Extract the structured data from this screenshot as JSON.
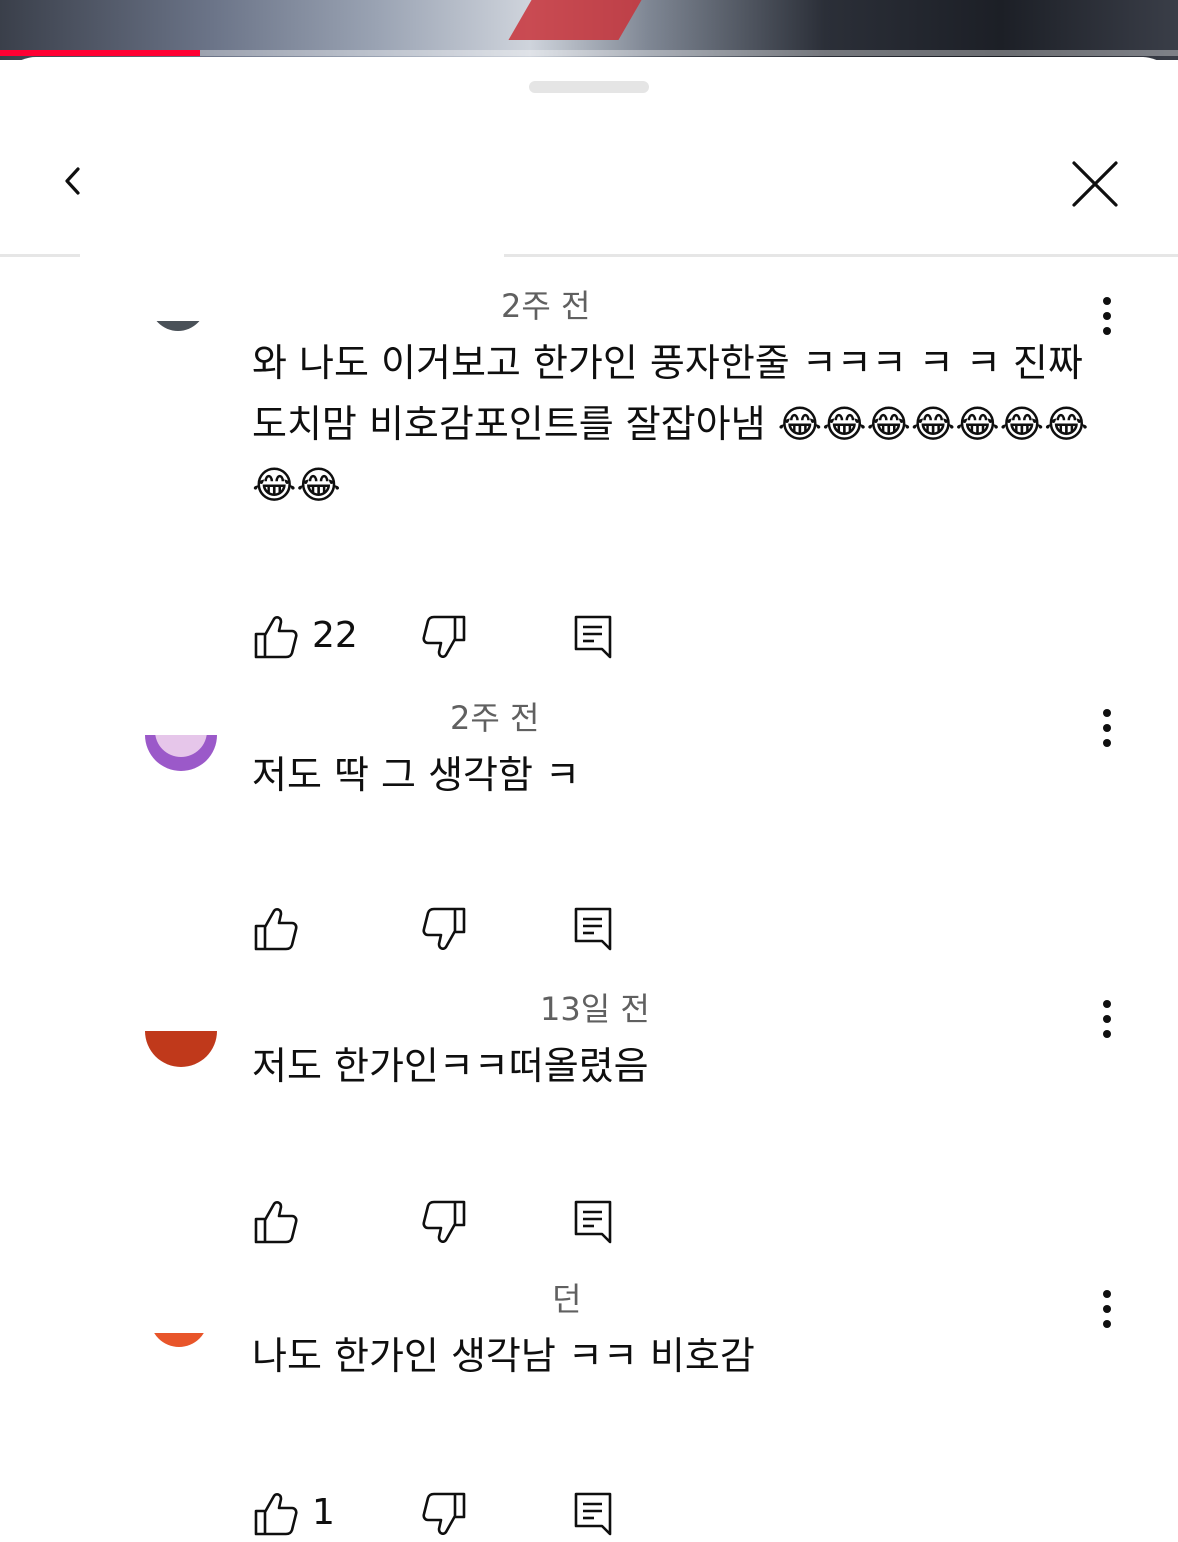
{
  "player": {
    "progress_percent": 17
  },
  "colors": {
    "progress": "#ff0033",
    "text_primary": "#0f0f0f",
    "text_secondary": "#606060"
  },
  "header": {
    "back_icon": "chevron-left-icon",
    "close_icon": "close-icon"
  },
  "comments": [
    {
      "time": "2주 전",
      "text": "와 나도 이거보고 한가인 풍자한줄 ㅋㅋㅋ ㅋ ㅋ 진짜 도치맘 비호감포인트를 잘잡아냄 😂😂😂😂😂😂😂😂😂",
      "likes": "22",
      "avatar_color": "#4a5158"
    },
    {
      "time": "2주 전",
      "text": "저도 딱 그 생각함 ㅋ",
      "likes": "",
      "avatar_color": "#9b59c9"
    },
    {
      "time": "13일 전",
      "text": "저도 한가인ㅋㅋ떠올렸음",
      "likes": "",
      "avatar_color": "#c0391b"
    },
    {
      "time": "던",
      "text": "나도 한가인 생각남 ㅋㅋ 비호감",
      "likes": "1",
      "avatar_color": "#e8552a"
    }
  ]
}
